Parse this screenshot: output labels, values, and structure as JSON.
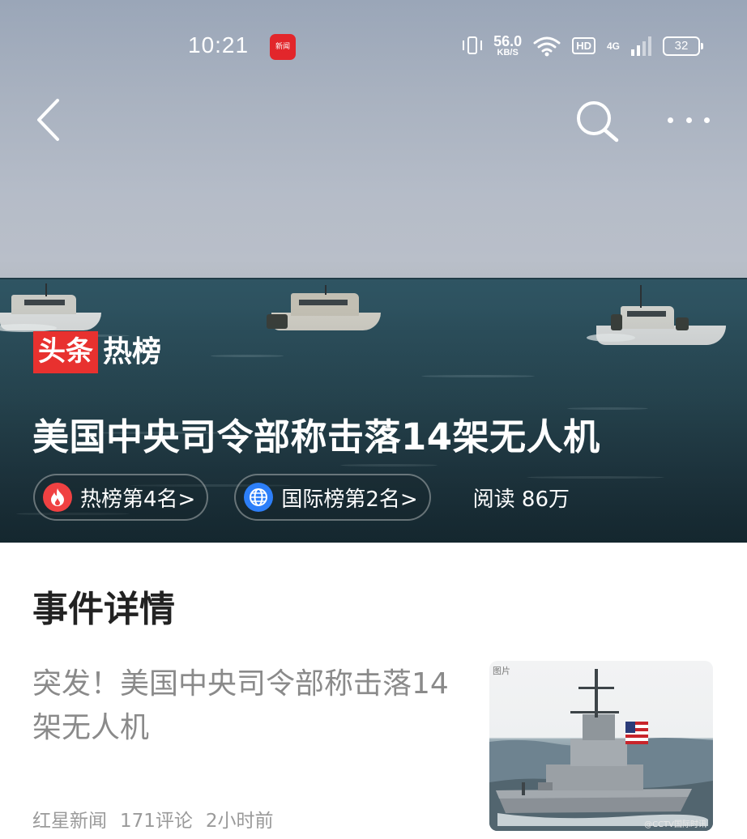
{
  "status_bar": {
    "time": "10:21",
    "app_badge": "新闻",
    "net_speed": "56.0",
    "net_unit": "KB/S",
    "hd": "HD",
    "network": "4G",
    "battery": "32"
  },
  "nav": {
    "back_icon": "chevron-left-icon",
    "search_icon": "search-icon",
    "more_icon": "more-icon"
  },
  "brand": {
    "part1": "头条",
    "part2": "热榜"
  },
  "hero": {
    "title": "美国中央司令部称击落14架无人机",
    "chips": [
      {
        "label": "热榜第4名>",
        "icon": "fire-icon"
      },
      {
        "label": "国际榜第2名>",
        "icon": "globe-icon"
      }
    ],
    "reads": "阅读 86万"
  },
  "section": {
    "title": "事件详情"
  },
  "article": {
    "title": "突发！美国中央司令部称击落14架无人机",
    "source": "红星新闻",
    "comments": "171评论",
    "time": "2小时前",
    "thumb_tag": "图片",
    "thumb_watermark": "@CCTV国际时讯"
  },
  "colors": {
    "brand_red": "#e8312f",
    "fire_red": "#f04142",
    "globe_blue": "#2d7ff9",
    "meta_gray": "#9a9a9a"
  }
}
